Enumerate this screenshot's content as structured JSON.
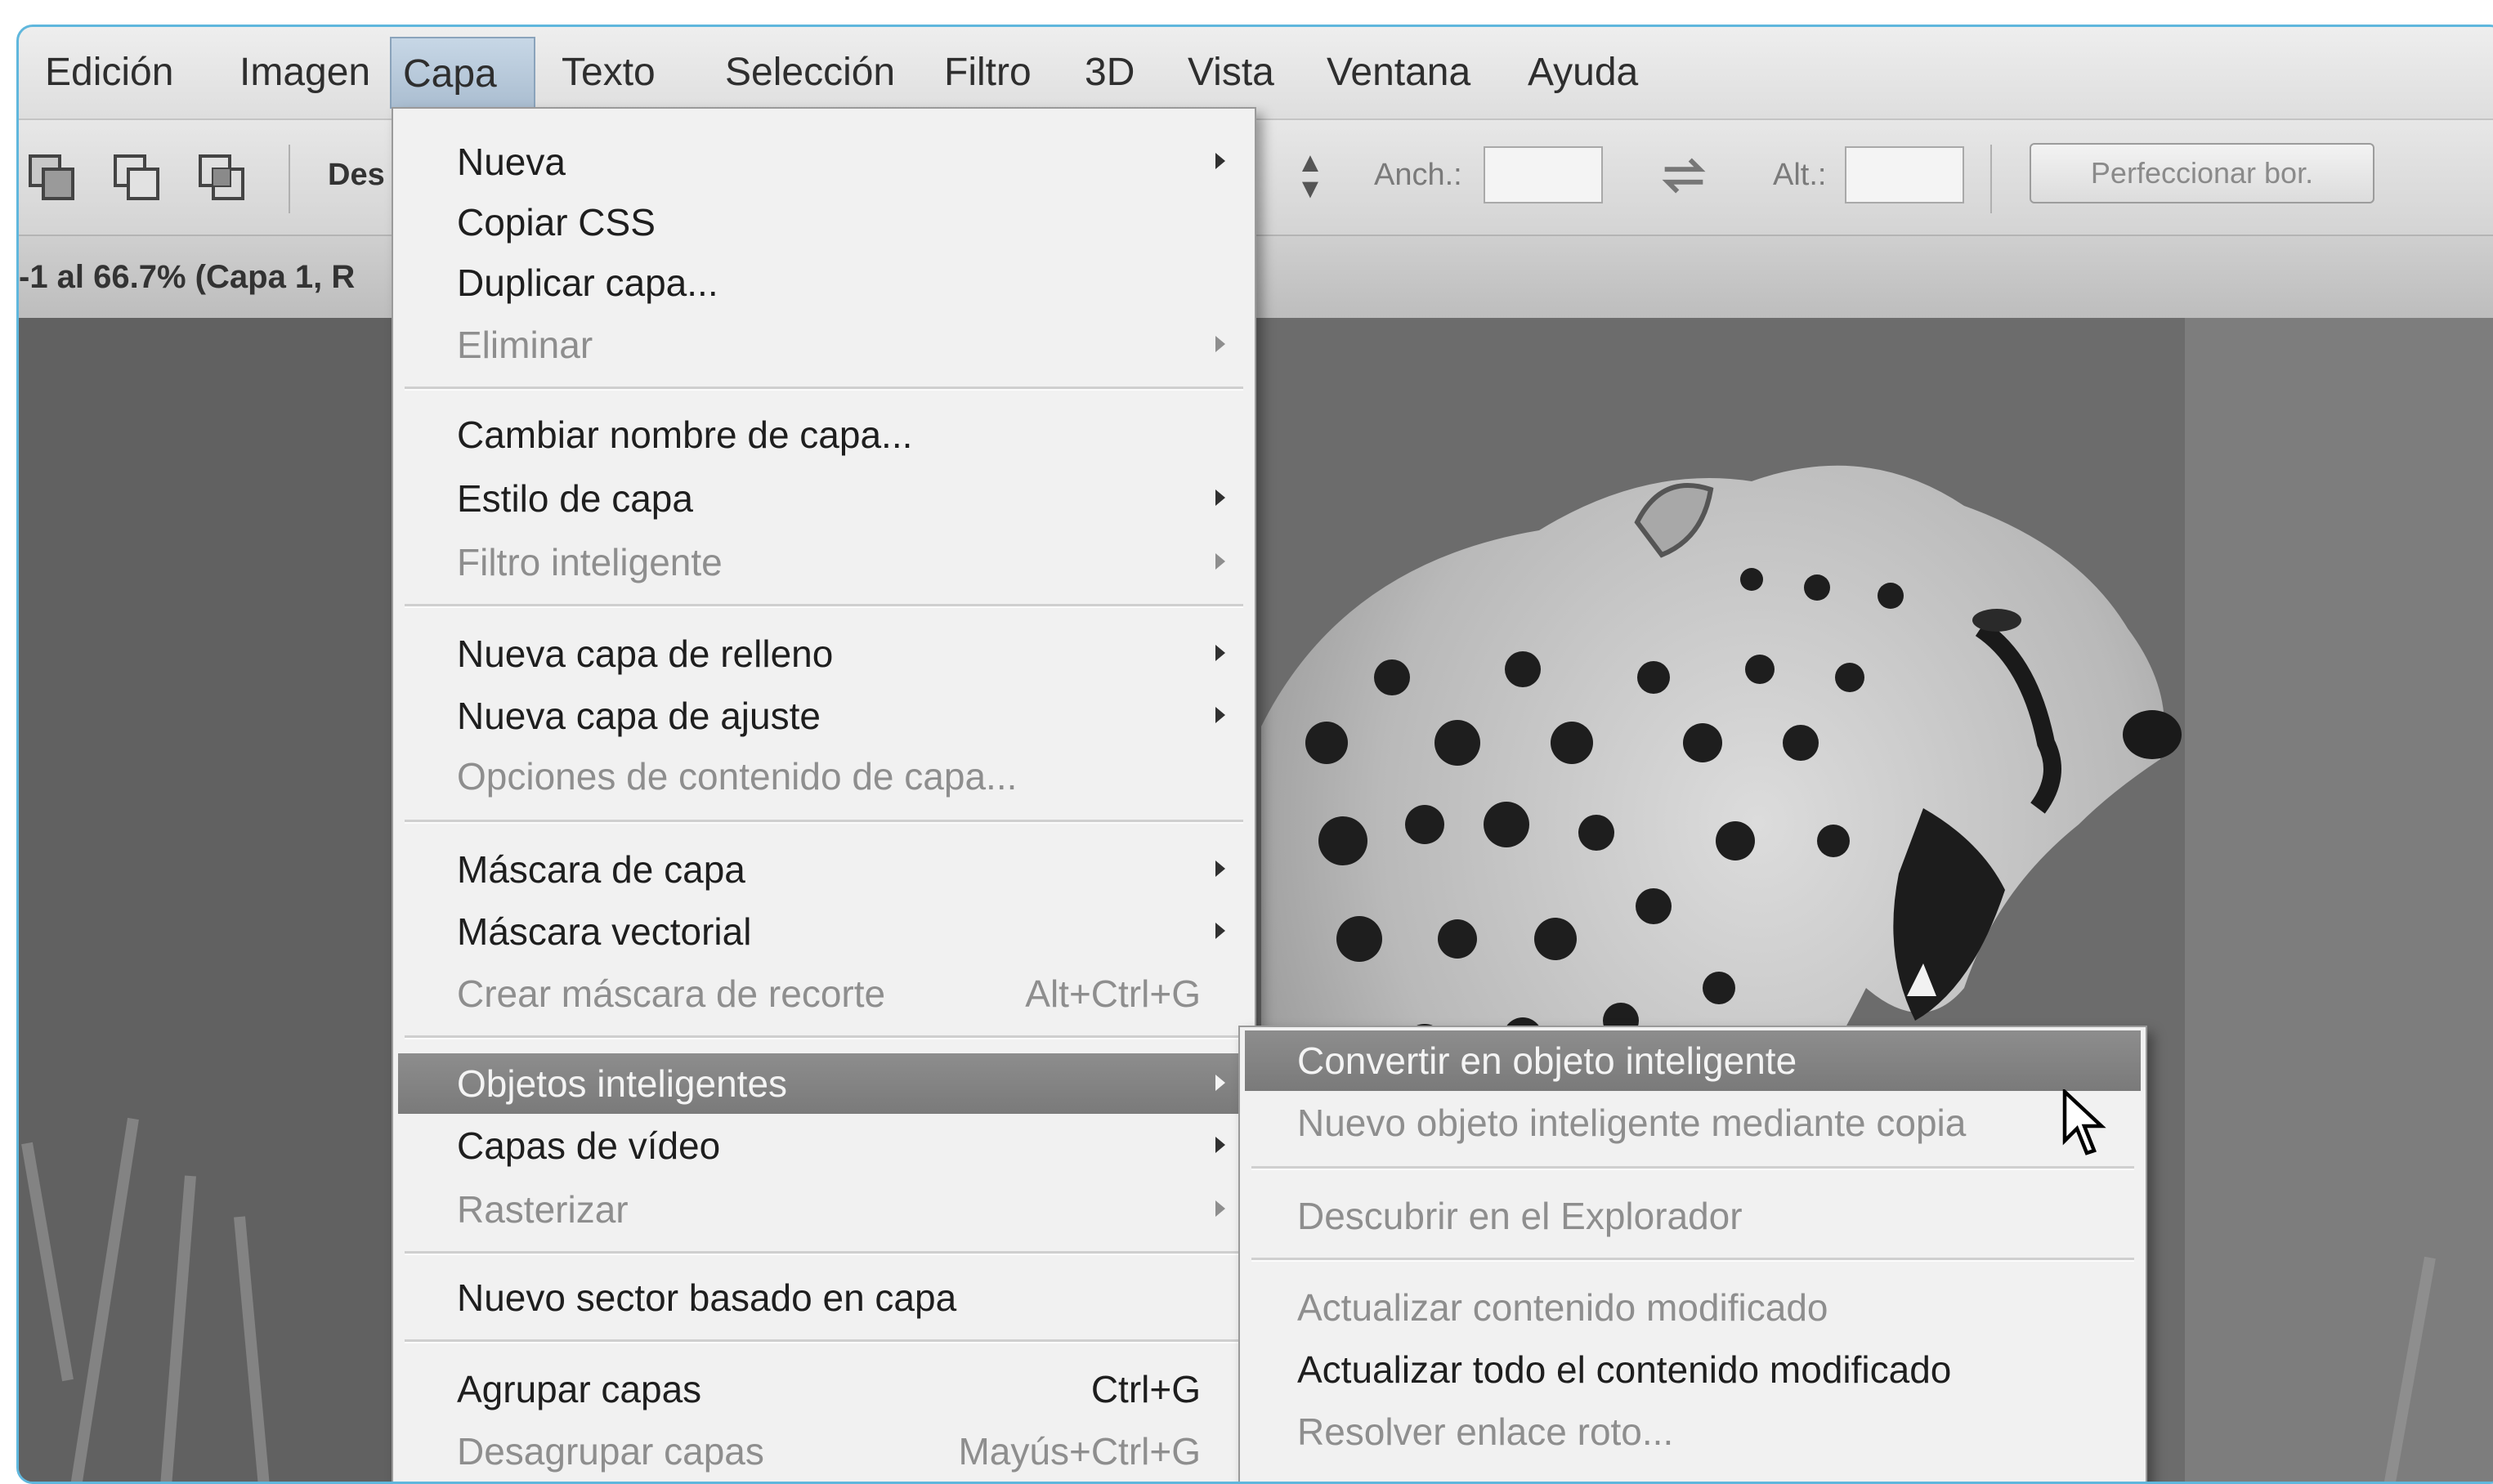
{
  "menubar": [
    {
      "id": "edicion",
      "label": "Edición"
    },
    {
      "id": "imagen",
      "label": "Imagen"
    },
    {
      "id": "capa",
      "label": "Capa"
    },
    {
      "id": "texto",
      "label": "Texto"
    },
    {
      "id": "seleccion",
      "label": "Selección"
    },
    {
      "id": "filtro",
      "label": "Filtro"
    },
    {
      "id": "3d",
      "label": "3D"
    },
    {
      "id": "vista",
      "label": "Vista"
    },
    {
      "id": "ventana",
      "label": "Ventana"
    },
    {
      "id": "ayuda",
      "label": "Ayuda"
    }
  ],
  "active_menu": "Capa",
  "options_bar": {
    "truncated_label": "Des",
    "width_label": "Anch.:",
    "height_label": "Alt.:",
    "refine_button": "Perfeccionar bor."
  },
  "document_tab": {
    "title": "-1 al 66.7% (Capa 1, R"
  },
  "capa_menu": [
    {
      "label": "Nueva",
      "submenu": true,
      "enabled": true
    },
    {
      "label": "Copiar CSS",
      "enabled": true
    },
    {
      "label": "Duplicar capa...",
      "enabled": true
    },
    {
      "label": "Eliminar",
      "submenu": true,
      "enabled": false
    },
    {
      "label": "Cambiar nombre de capa...",
      "enabled": true
    },
    {
      "label": "Estilo de capa",
      "submenu": true,
      "enabled": true
    },
    {
      "label": "Filtro inteligente",
      "submenu": true,
      "enabled": false
    },
    {
      "label": "Nueva capa de relleno",
      "submenu": true,
      "enabled": true
    },
    {
      "label": "Nueva capa de ajuste",
      "submenu": true,
      "enabled": true
    },
    {
      "label": "Opciones de contenido de capa...",
      "enabled": false
    },
    {
      "label": "Máscara de capa",
      "submenu": true,
      "enabled": true
    },
    {
      "label": "Máscara vectorial",
      "submenu": true,
      "enabled": true
    },
    {
      "label": "Crear máscara de recorte",
      "shortcut": "Alt+Ctrl+G",
      "enabled": false
    },
    {
      "label": "Objetos inteligentes",
      "submenu": true,
      "enabled": true,
      "highlighted": true
    },
    {
      "label": "Capas de vídeo",
      "submenu": true,
      "enabled": true
    },
    {
      "label": "Rasterizar",
      "submenu": true,
      "enabled": false
    },
    {
      "label": "Nuevo sector basado en capa",
      "enabled": true
    },
    {
      "label": "Agrupar capas",
      "shortcut": "Ctrl+G",
      "enabled": true
    },
    {
      "label": "Desagrupar capas",
      "shortcut": "Mayús+Ctrl+G",
      "enabled": false
    }
  ],
  "smart_objects_submenu": [
    {
      "label": "Convertir en objeto inteligente",
      "enabled": true,
      "highlighted": true
    },
    {
      "label": "Nuevo objeto inteligente mediante copia",
      "enabled": false
    },
    {
      "label": "Descubrir en el Explorador",
      "enabled": false
    },
    {
      "label": "Actualizar contenido modificado",
      "enabled": false
    },
    {
      "label": "Actualizar todo el contenido modificado",
      "enabled": true
    },
    {
      "label": "Resolver enlace roto...",
      "enabled": false
    }
  ],
  "icons": {
    "tool_icons": [
      "new-selection-icon",
      "add-to-selection-icon",
      "intersect-selection-icon"
    ],
    "swap_icon": "swap-arrows-icon",
    "cursor": "mouse-pointer-icon"
  },
  "canvas_image": "cheetah-photo"
}
